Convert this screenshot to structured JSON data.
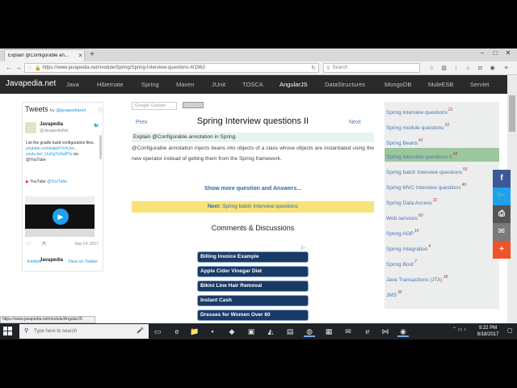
{
  "browser": {
    "tab_title": "Explain @Configurable an...",
    "url": "https://www.javapedia.net/module/Spring/Spring-Interview-questions-II/1962",
    "search_placeholder": "Search"
  },
  "site_nav": {
    "brand": "Javapedia.net",
    "items": [
      "Java",
      "Hibernate",
      "Spring",
      "Maven",
      "JUnit",
      "TOSCA",
      "AngularJS",
      "DataStructures",
      "MongoDB",
      "MuleESB",
      "Servlet"
    ]
  },
  "tweets": {
    "title": "Tweets",
    "by_prefix": "by",
    "by_handle": "@javapedianet",
    "author_name": "Javapedia",
    "author_handle": "@JavapediaNet",
    "tweet_text": "List the gradle build configuration files.",
    "tweet_link": "youtube.com/watch?v=Uuc...",
    "tweet_link2": "youtu.be/_UuCg7aSw8?a",
    "tweet_via": "via @YouTube",
    "yt_label": "YouTube",
    "yt_handle": "@YouTube",
    "date": "Sep 14, 2017",
    "embed": "Embed",
    "view_on_twitter": "View on Twitter"
  },
  "main": {
    "search_placeholder": "Google Custom",
    "prev": "Prev",
    "next": "Next",
    "title": "Spring Interview questions II",
    "question": "Explain @Configurable annotation in Spring.",
    "answer": "@Configurable annotation injects beans into objects of a class whose objects are instantiated using the new operator instead of getting them from the Spring framework.",
    "show_more": "Show more question and Answers...",
    "next_label": "Next:",
    "next_link": "Spring batch Interview questions",
    "comments": "Comments & Discussions"
  },
  "ads": {
    "ad_choice": "▷",
    "items": [
      "Billing Invoice Example",
      "Apple Cider Vinegar Diet",
      "Bikini Line Hair Removal",
      "Instant Cash",
      "Dresses for Women Over 60"
    ]
  },
  "sidebar": {
    "items": [
      {
        "label": "Spring interview questions",
        "count": "21"
      },
      {
        "label": "Spring module questions",
        "count": "10"
      },
      {
        "label": "Spring Beans",
        "count": "41"
      },
      {
        "label": "Spring Interview questions II",
        "count": "34"
      },
      {
        "label": "Spring batch Interview questions",
        "count": "55"
      },
      {
        "label": "Spring MVC Interview questions",
        "count": "49"
      },
      {
        "label": "Spring Data Access",
        "count": "31"
      },
      {
        "label": "Web services",
        "count": "60"
      },
      {
        "label": "Spring AOP",
        "count": "16"
      },
      {
        "label": "Spring Integration",
        "count": "4"
      },
      {
        "label": "Spring Boot",
        "count": "7"
      },
      {
        "label": "Java Transactions (JTA)",
        "count": "18"
      },
      {
        "label": "JMS",
        "count": "35"
      }
    ]
  },
  "status_url": "https://www.javapedia.net/module/AngularJS",
  "taskbar": {
    "search_placeholder": "Type here to search",
    "time": "9:22 PM",
    "date": "9/18/2017"
  },
  "colors": {
    "nav_bg": "#2a2a2a",
    "link": "#4a77b4",
    "active_sidebar": "#9cc79c",
    "next_bar": "#f8e27a",
    "facebook": "#3b5998",
    "twitter": "#1da1f2",
    "print": "#555555",
    "email": "#7a7a7a",
    "more": "#f0522b"
  }
}
